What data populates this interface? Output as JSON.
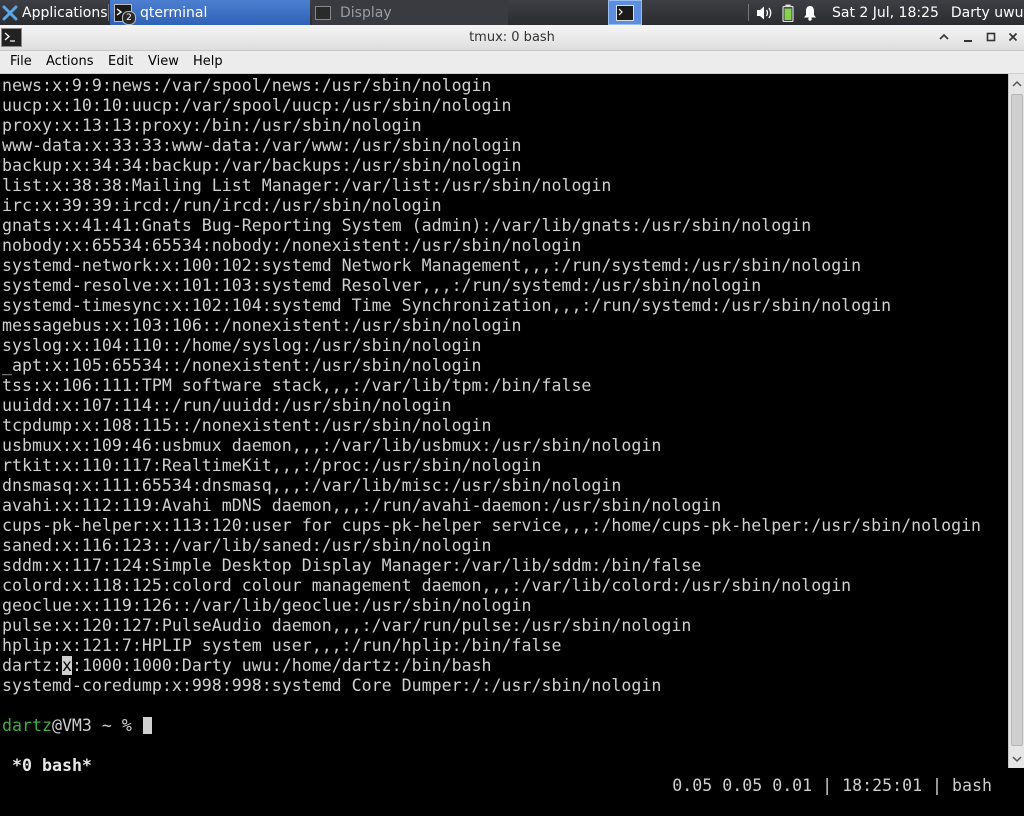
{
  "panel": {
    "apps_label": "Applications",
    "tasks": [
      {
        "label": "qterminal",
        "badge": "2"
      },
      {
        "label": "Display"
      }
    ],
    "clock": "Sat  2 Jul, 18:25",
    "user": "Darty uwu"
  },
  "window": {
    "title": "tmux: 0 bash"
  },
  "menu": {
    "items": [
      "File",
      "Actions",
      "Edit",
      "View",
      "Help"
    ]
  },
  "terminal": {
    "lines": [
      "news:x:9:9:news:/var/spool/news:/usr/sbin/nologin",
      "uucp:x:10:10:uucp:/var/spool/uucp:/usr/sbin/nologin",
      "proxy:x:13:13:proxy:/bin:/usr/sbin/nologin",
      "www-data:x:33:33:www-data:/var/www:/usr/sbin/nologin",
      "backup:x:34:34:backup:/var/backups:/usr/sbin/nologin",
      "list:x:38:38:Mailing List Manager:/var/list:/usr/sbin/nologin",
      "irc:x:39:39:ircd:/run/ircd:/usr/sbin/nologin",
      "gnats:x:41:41:Gnats Bug-Reporting System (admin):/var/lib/gnats:/usr/sbin/nologin",
      "nobody:x:65534:65534:nobody:/nonexistent:/usr/sbin/nologin",
      "systemd-network:x:100:102:systemd Network Management,,,:/run/systemd:/usr/sbin/nologin",
      "systemd-resolve:x:101:103:systemd Resolver,,,:/run/systemd:/usr/sbin/nologin",
      "systemd-timesync:x:102:104:systemd Time Synchronization,,,:/run/systemd:/usr/sbin/nologin",
      "messagebus:x:103:106::/nonexistent:/usr/sbin/nologin",
      "syslog:x:104:110::/home/syslog:/usr/sbin/nologin",
      "_apt:x:105:65534::/nonexistent:/usr/sbin/nologin",
      "tss:x:106:111:TPM software stack,,,:/var/lib/tpm:/bin/false",
      "uuidd:x:107:114::/run/uuidd:/usr/sbin/nologin",
      "tcpdump:x:108:115::/nonexistent:/usr/sbin/nologin",
      "usbmux:x:109:46:usbmux daemon,,,:/var/lib/usbmux:/usr/sbin/nologin",
      "rtkit:x:110:117:RealtimeKit,,,:/proc:/usr/sbin/nologin",
      "dnsmasq:x:111:65534:dnsmasq,,,:/var/lib/misc:/usr/sbin/nologin",
      "avahi:x:112:119:Avahi mDNS daemon,,,:/run/avahi-daemon:/usr/sbin/nologin",
      "cups-pk-helper:x:113:120:user for cups-pk-helper service,,,:/home/cups-pk-helper:/usr/sbin/nologin",
      "saned:x:116:123::/var/lib/saned:/usr/sbin/nologin",
      "sddm:x:117:124:Simple Desktop Display Manager:/var/lib/sddm:/bin/false",
      "colord:x:118:125:colord colour management daemon,,,:/var/lib/colord:/usr/sbin/nologin",
      "geoclue:x:119:126::/var/lib/geoclue:/usr/sbin/nologin",
      "pulse:x:120:127:PulseAudio daemon,,,:/var/run/pulse:/usr/sbin/nologin",
      "hplip:x:121:7:HPLIP system user,,,:/run/hplip:/bin/false",
      "dartz:x:1000:1000:Darty uwu:/home/dartz:/bin/bash",
      "systemd-coredump:x:998:998:systemd Core Dumper:/:/usr/sbin/nologin"
    ],
    "prompt_user": "dartz",
    "prompt_rest": "@VM3 ~ % ",
    "status_left": "*0 bash*",
    "status_right": "0.05 0.05 0.01 | 18:25:01 | bash"
  }
}
